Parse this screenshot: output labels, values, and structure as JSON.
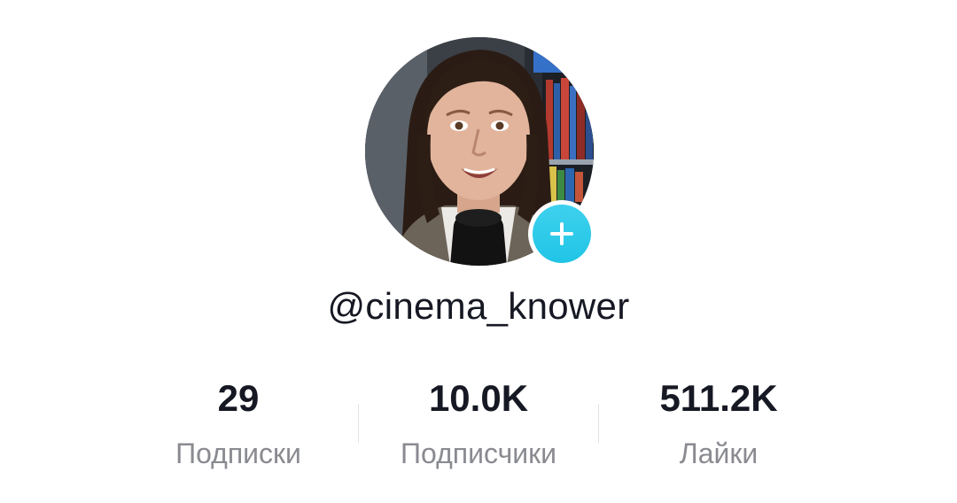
{
  "profile": {
    "username": "@cinema_knower",
    "avatar_icon": "user-avatar-photo",
    "follow_icon": "plus-icon",
    "follow_color": "#20c4e6"
  },
  "stats": {
    "following": {
      "value": "29",
      "label": "Подписки"
    },
    "followers": {
      "value": "10.0K",
      "label": "Подписчики"
    },
    "likes": {
      "value": "511.2K",
      "label": "Лайки"
    }
  }
}
